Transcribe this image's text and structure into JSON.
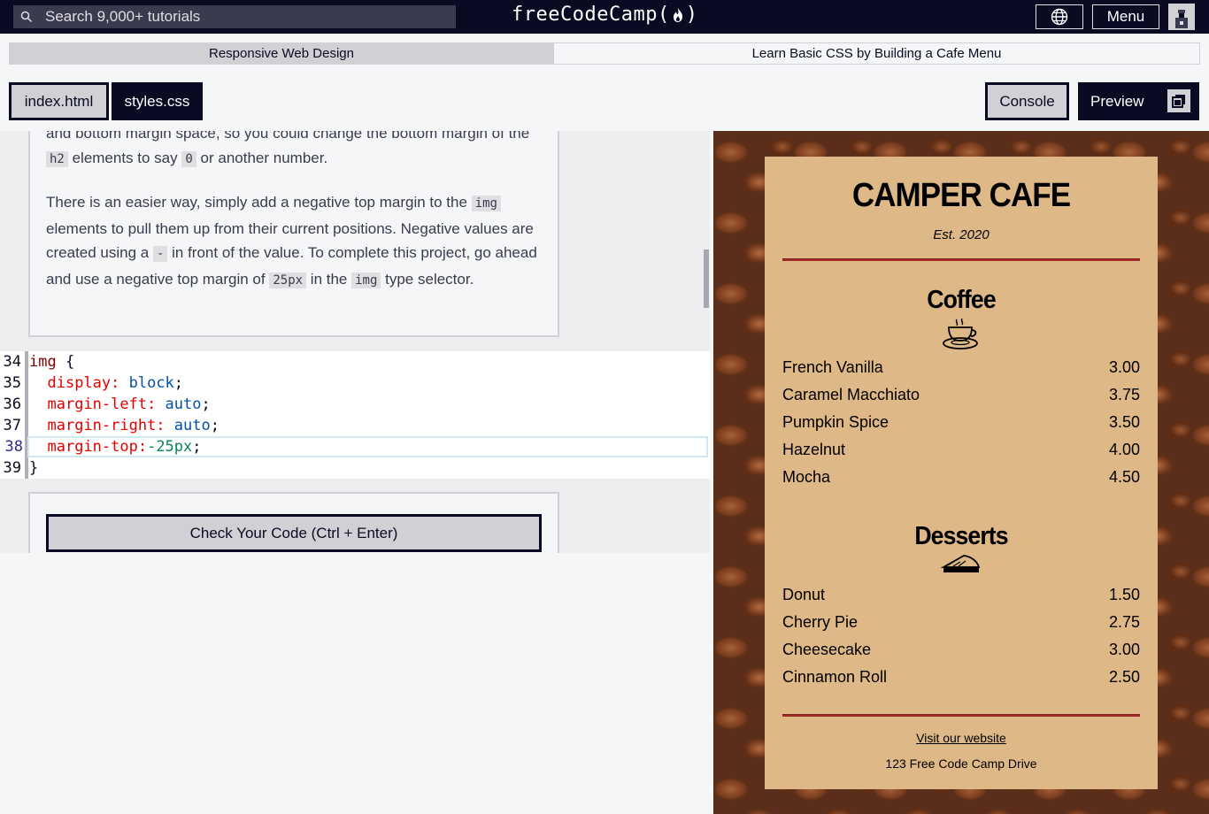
{
  "nav": {
    "search_placeholder": "Search 9,000+ tutorials",
    "logo_text_left": "freeCodeCamp(",
    "logo_text_right": ")",
    "menu_label": "Menu",
    "icons": [
      "search-icon",
      "globe-icon",
      "flame-icon",
      "avatar-icon"
    ]
  },
  "breadcrumb": {
    "superblock": "Responsive Web Design",
    "challenge": "Learn Basic CSS by Building a Cafe Menu"
  },
  "tabs": {
    "index": "index.html",
    "styles": "styles.css",
    "console": "Console",
    "preview": "Preview"
  },
  "instructions": {
    "p1_part1": "and bottom margin space, so you could change the bottom margin of the ",
    "p1_code1": "h2",
    "p1_part2": " elements to say ",
    "p1_code2": "0",
    "p1_part3": " or another number.",
    "p2_part1": "There is an easier way, simply add a negative top margin to the ",
    "p2_code1": "img",
    "p2_part2": " elements to pull them up from their current positions. Negative values are created using a ",
    "p2_code2": "-",
    "p2_part3": " in front of the value. To complete this project, go ahead and use a negative top margin of ",
    "p2_code3": "25px",
    "p2_part4": " in the ",
    "p2_code4": "img",
    "p2_part5": " type selector."
  },
  "editor": {
    "lines": [
      {
        "num": "34",
        "selector": "img",
        "open": " {"
      },
      {
        "num": "35",
        "prop": "display:",
        "value": " block",
        "end": ";"
      },
      {
        "num": "36",
        "prop": "margin-left:",
        "value": " auto",
        "end": ";"
      },
      {
        "num": "37",
        "prop": "margin-right:",
        "value": " auto",
        "end": ";"
      },
      {
        "num": "38",
        "prop": "margin-top:",
        "value": "-25px",
        "end": ";"
      },
      {
        "num": "39",
        "close": "}"
      }
    ]
  },
  "check_button": "Check Your Code (Ctrl + Enter)",
  "preview": {
    "title": "CAMPER CAFE",
    "established": "Est. 2020",
    "coffee_heading": "Coffee",
    "coffee_items": [
      {
        "name": "French Vanilla",
        "price": "3.00"
      },
      {
        "name": "Caramel Macchiato",
        "price": "3.75"
      },
      {
        "name": "Pumpkin Spice",
        "price": "3.50"
      },
      {
        "name": "Hazelnut",
        "price": "4.00"
      },
      {
        "name": "Mocha",
        "price": "4.50"
      }
    ],
    "desserts_heading": "Desserts",
    "dessert_items": [
      {
        "name": "Donut",
        "price": "1.50"
      },
      {
        "name": "Cherry Pie",
        "price": "2.75"
      },
      {
        "name": "Cheesecake",
        "price": "3.00"
      },
      {
        "name": "Cinnamon Roll",
        "price": "2.50"
      }
    ],
    "website_link": "Visit our website",
    "address": "123 Free Code Camp Drive"
  },
  "colors": {
    "nav_bg": "#0a0a23",
    "menu_bg": "#deb887",
    "divider": "#a52a2a"
  }
}
